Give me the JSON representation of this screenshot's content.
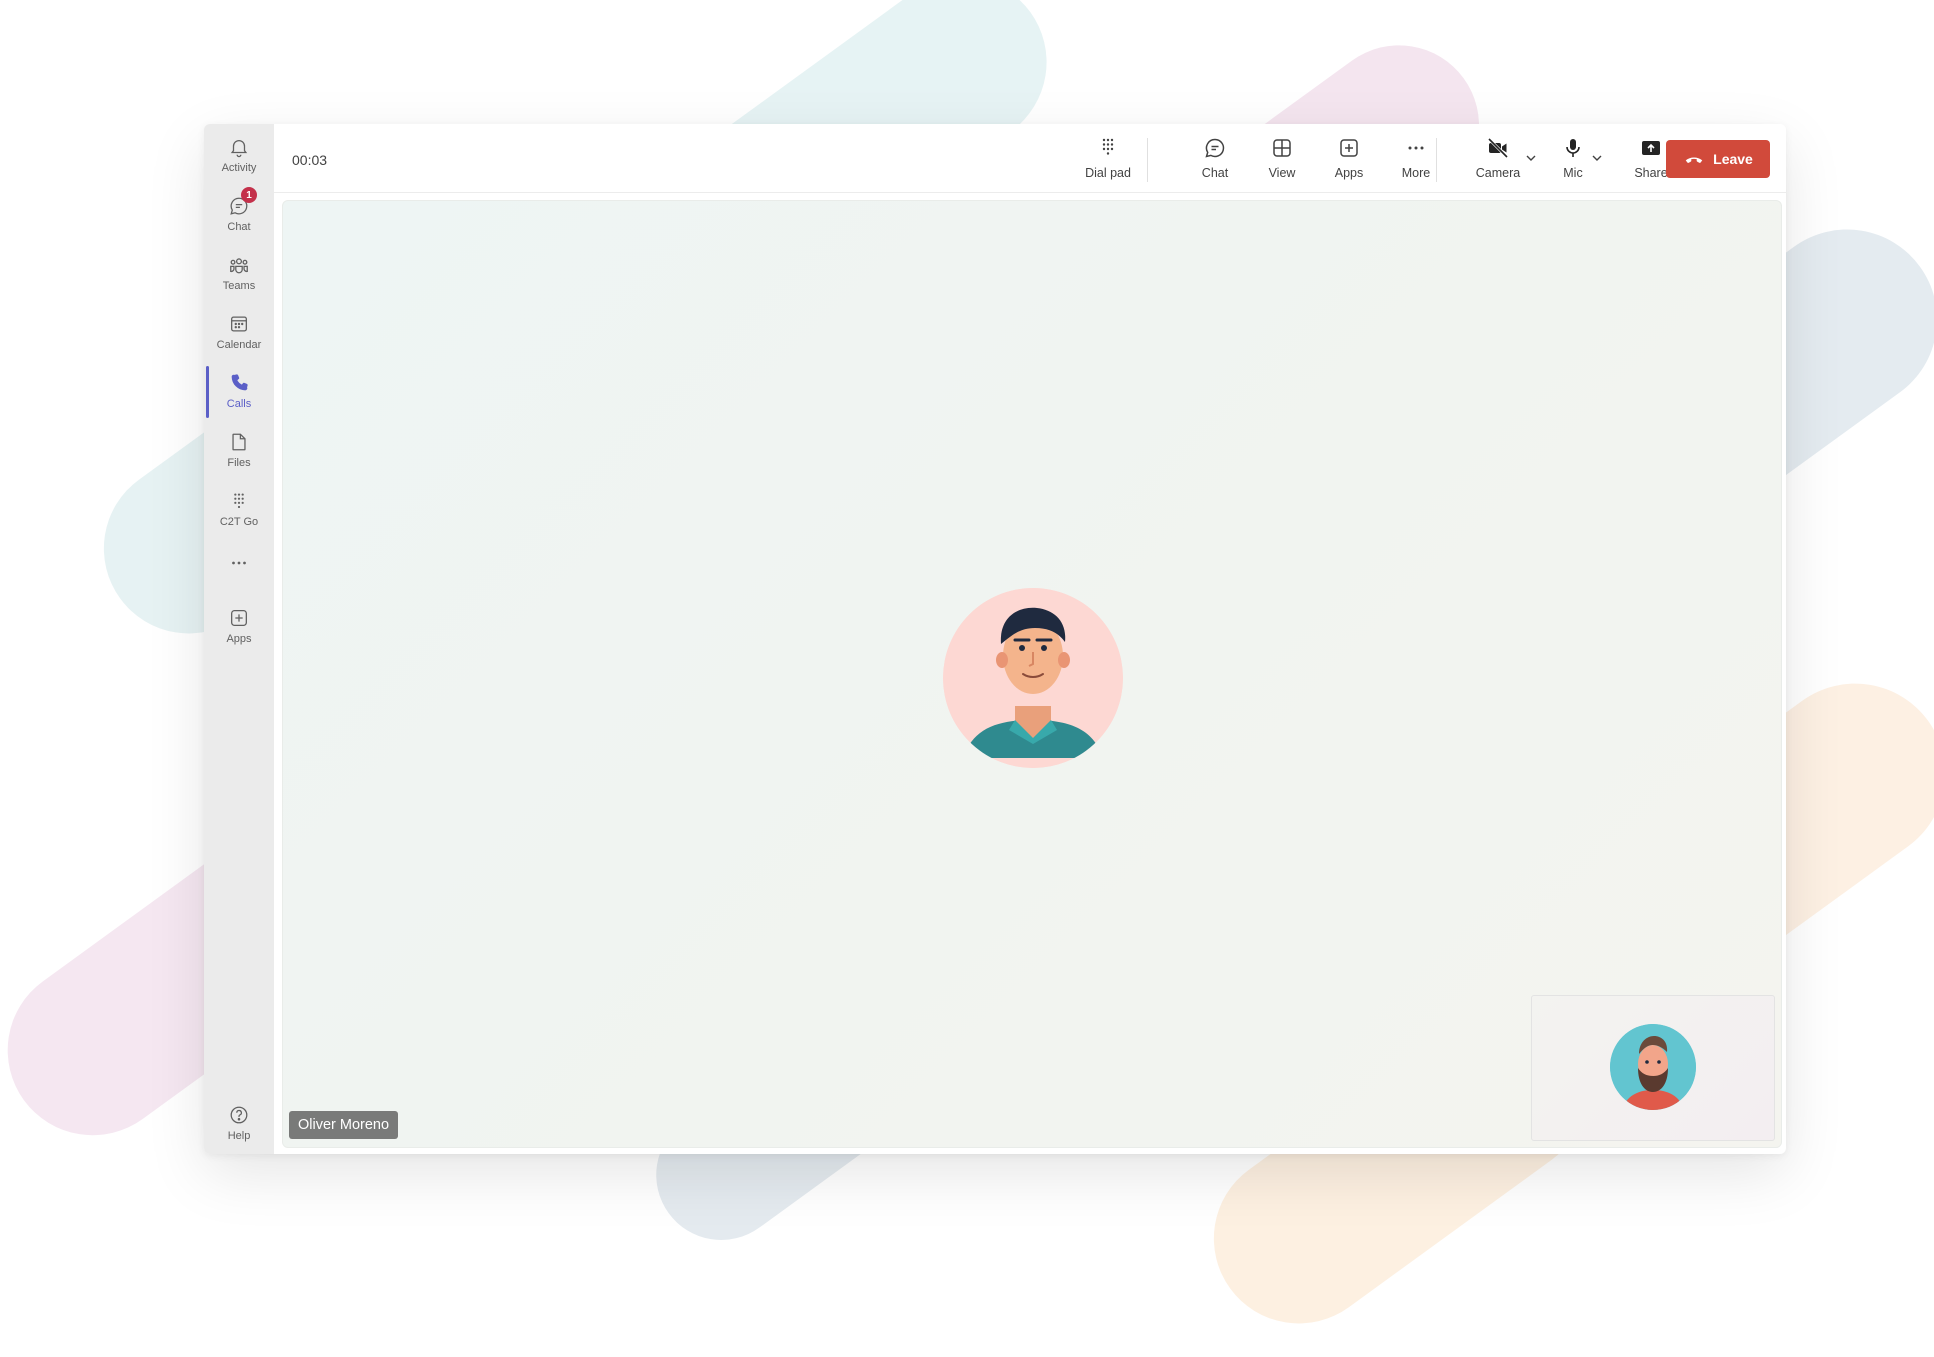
{
  "rail": {
    "items": [
      {
        "label": "Activity",
        "icon": "bell-icon"
      },
      {
        "label": "Chat",
        "icon": "chat-icon",
        "badge": "1"
      },
      {
        "label": "Teams",
        "icon": "teams-icon"
      },
      {
        "label": "Calendar",
        "icon": "calendar-icon"
      },
      {
        "label": "Calls",
        "icon": "phone-icon",
        "active": true
      },
      {
        "label": "Files",
        "icon": "file-icon"
      },
      {
        "label": "C2T Go",
        "icon": "dialpad-icon"
      },
      {
        "label": "Apps",
        "icon": "add-app-icon"
      }
    ],
    "help_label": "Help"
  },
  "call": {
    "timer": "00:03",
    "toolbar": {
      "dialpad_label": "Dial pad",
      "chat_label": "Chat",
      "view_label": "View",
      "apps_label": "Apps",
      "more_label": "More",
      "camera_label": "Camera",
      "mic_label": "Mic",
      "share_label": "Share",
      "leave_label": "Leave"
    },
    "participant_name": "Oliver Moreno"
  },
  "colors": {
    "accent": "#5b5fc7",
    "leave": "#d14a3b",
    "badge": "#c4314b"
  }
}
